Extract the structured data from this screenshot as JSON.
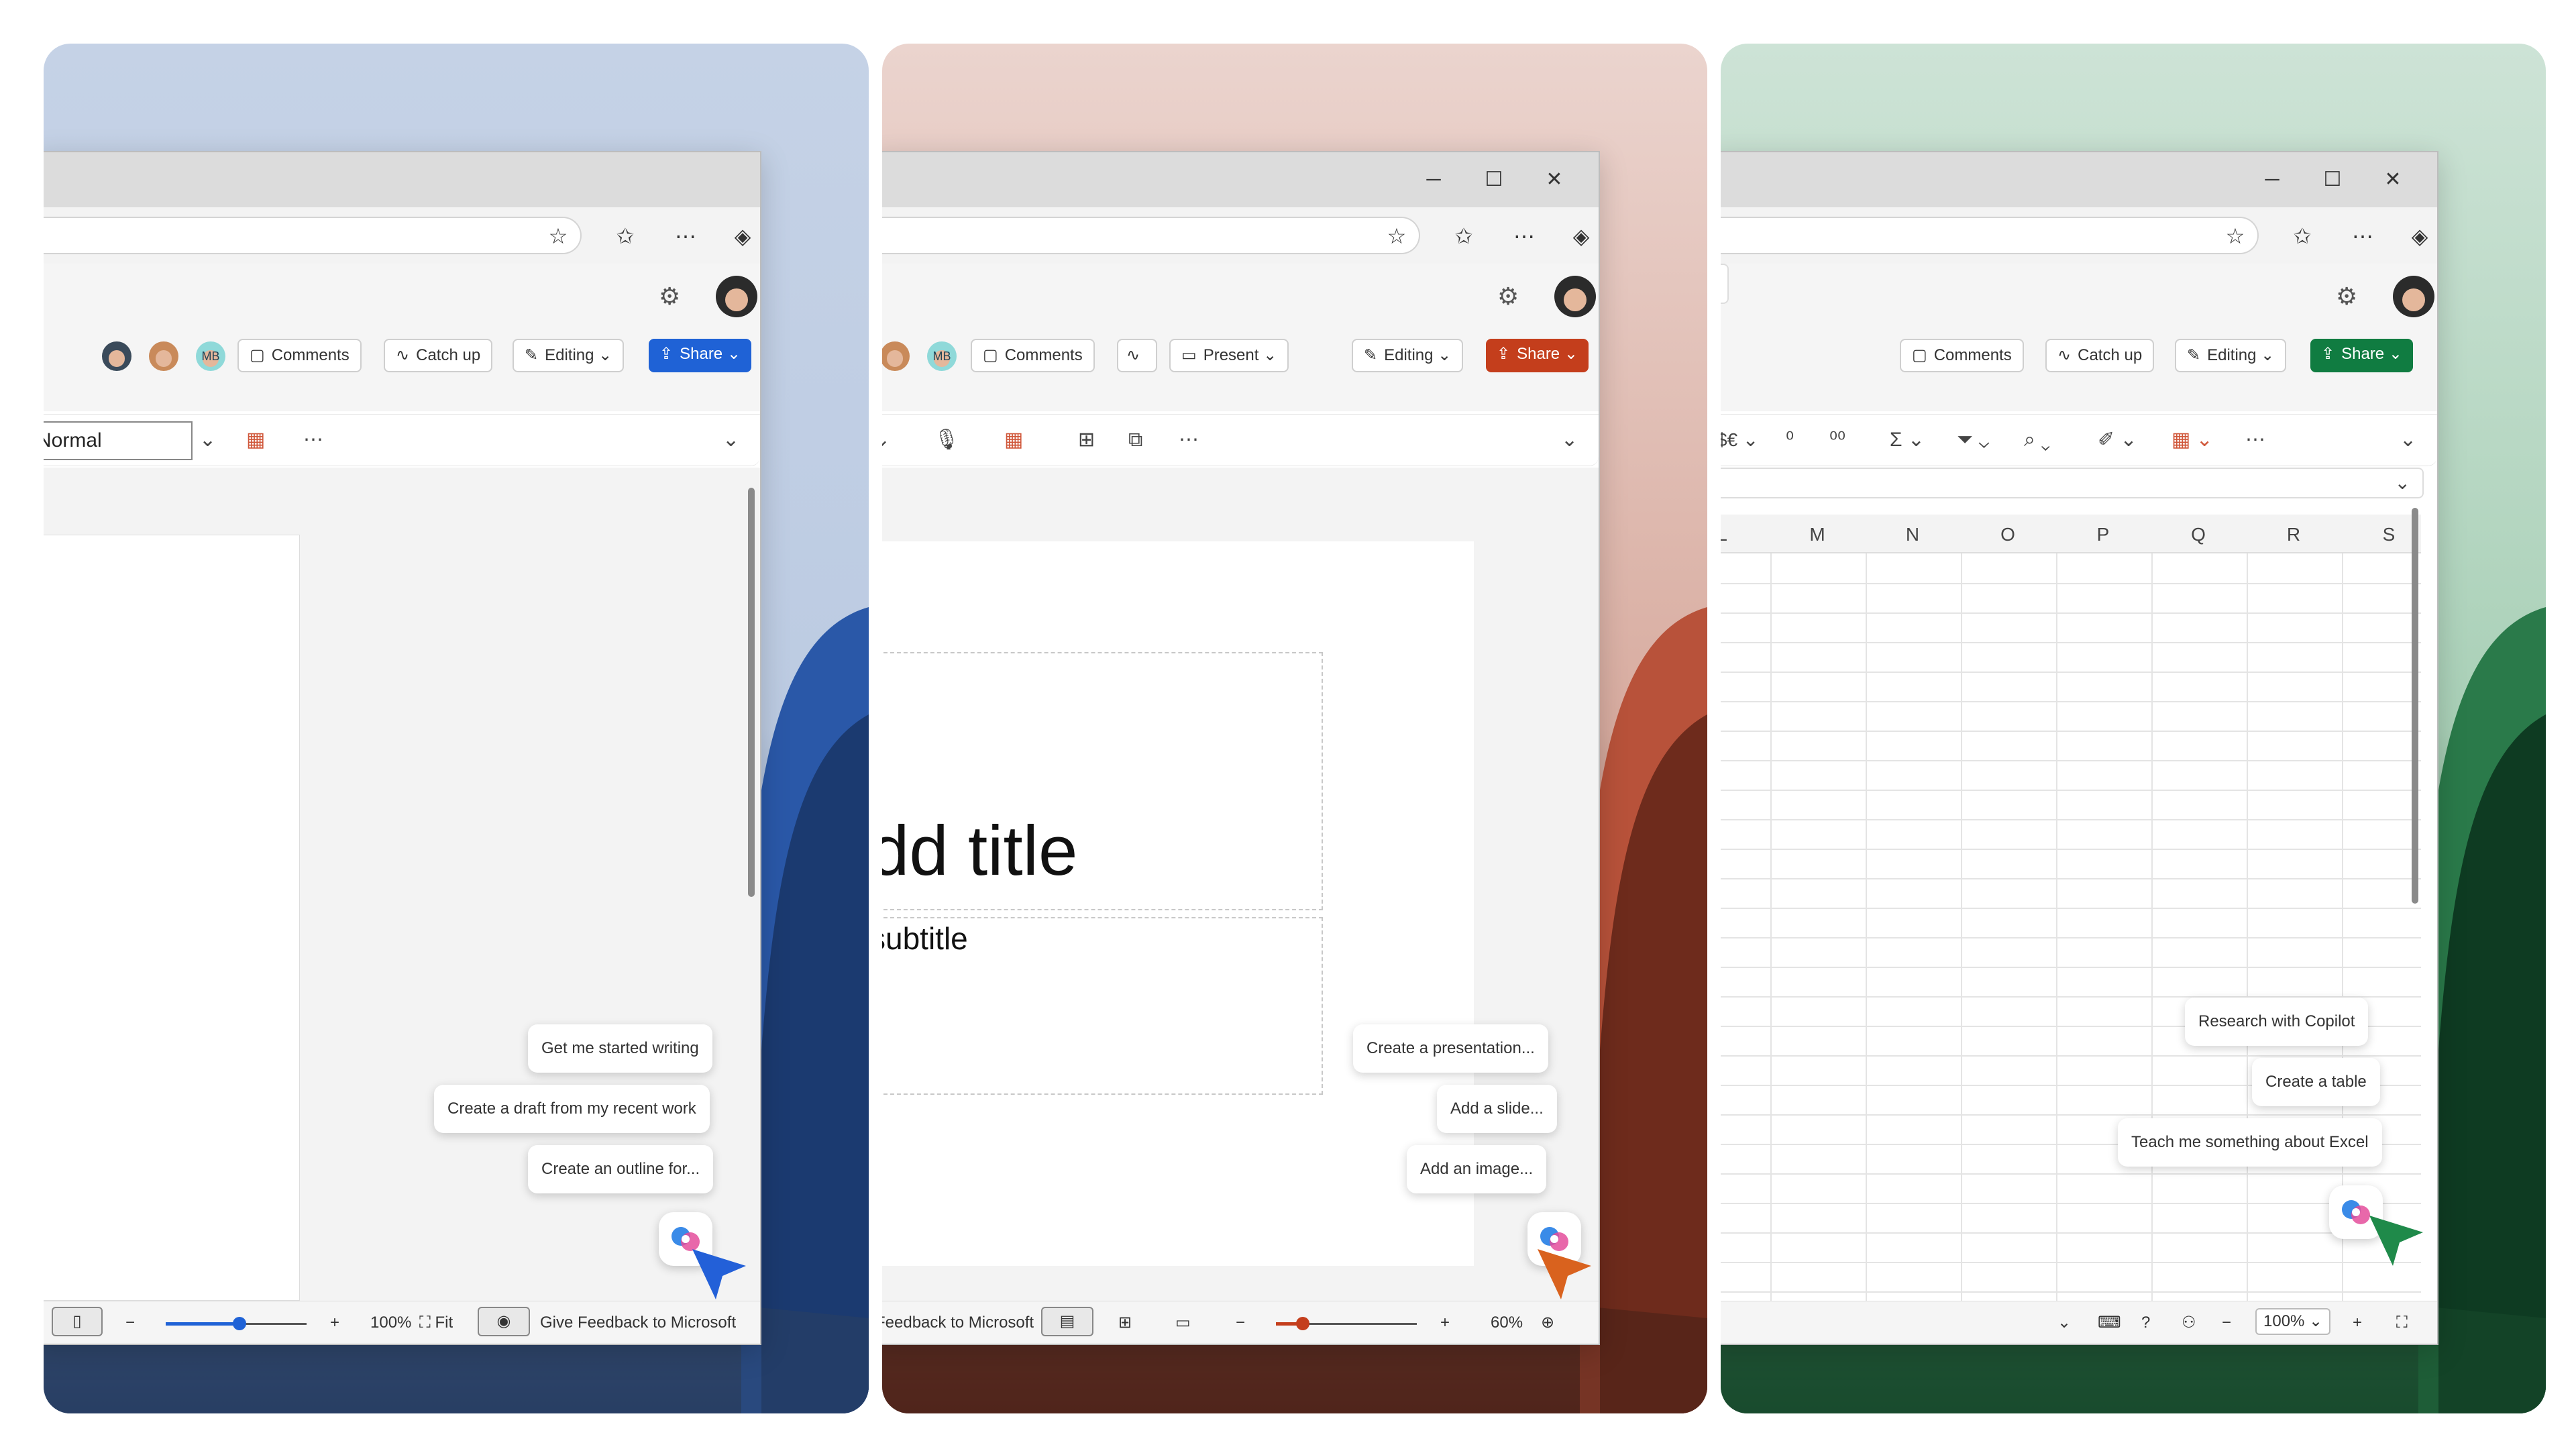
{
  "panels": {
    "word": {
      "accent": "#1f62d6",
      "style_box": "Normal",
      "pills": {
        "comments": "Comments",
        "catchup": "Catch up",
        "editing": "Editing",
        "share": "Share"
      },
      "avatar_initials": "MB",
      "suggestions": [
        "Get me started writing",
        "Create a draft from my recent work",
        "Create an outline for..."
      ],
      "status": {
        "zoom": "100%",
        "fit": "Fit",
        "feedback": "Give Feedback to Microsoft"
      }
    },
    "powerpoint": {
      "accent": "#c43e1c",
      "slide_title": "dd title",
      "slide_subtitle": "subtitle",
      "avatar_initials": "MB",
      "pills": {
        "comments": "Comments",
        "present": "Present",
        "editing": "Editing",
        "share": "Share"
      },
      "suggestions": [
        "Create a presentation...",
        "Add a slide...",
        "Add an image..."
      ],
      "status": {
        "feedback": "Feedback to Microsoft",
        "zoom": "60%"
      }
    },
    "excel": {
      "accent": "#107c41",
      "pills": {
        "comments": "Comments",
        "catchup": "Catch up",
        "editing": "Editing",
        "share": "Share"
      },
      "currency": "$€",
      "columns": [
        "L",
        "M",
        "N",
        "O",
        "P",
        "Q",
        "R",
        "S"
      ],
      "suggestions": [
        "Research with Copilot",
        "Create a table",
        "Teach me something about Excel"
      ],
      "status": {
        "zoom": "100%"
      }
    }
  },
  "icons": {
    "minimize": "minimize-icon",
    "maximize": "maximize-icon",
    "close": "close-icon",
    "favorite": "star-add-icon",
    "favorites": "favorites-icon",
    "more": "more-icon",
    "copilot": "copilot-icon",
    "settings": "gear-icon"
  }
}
